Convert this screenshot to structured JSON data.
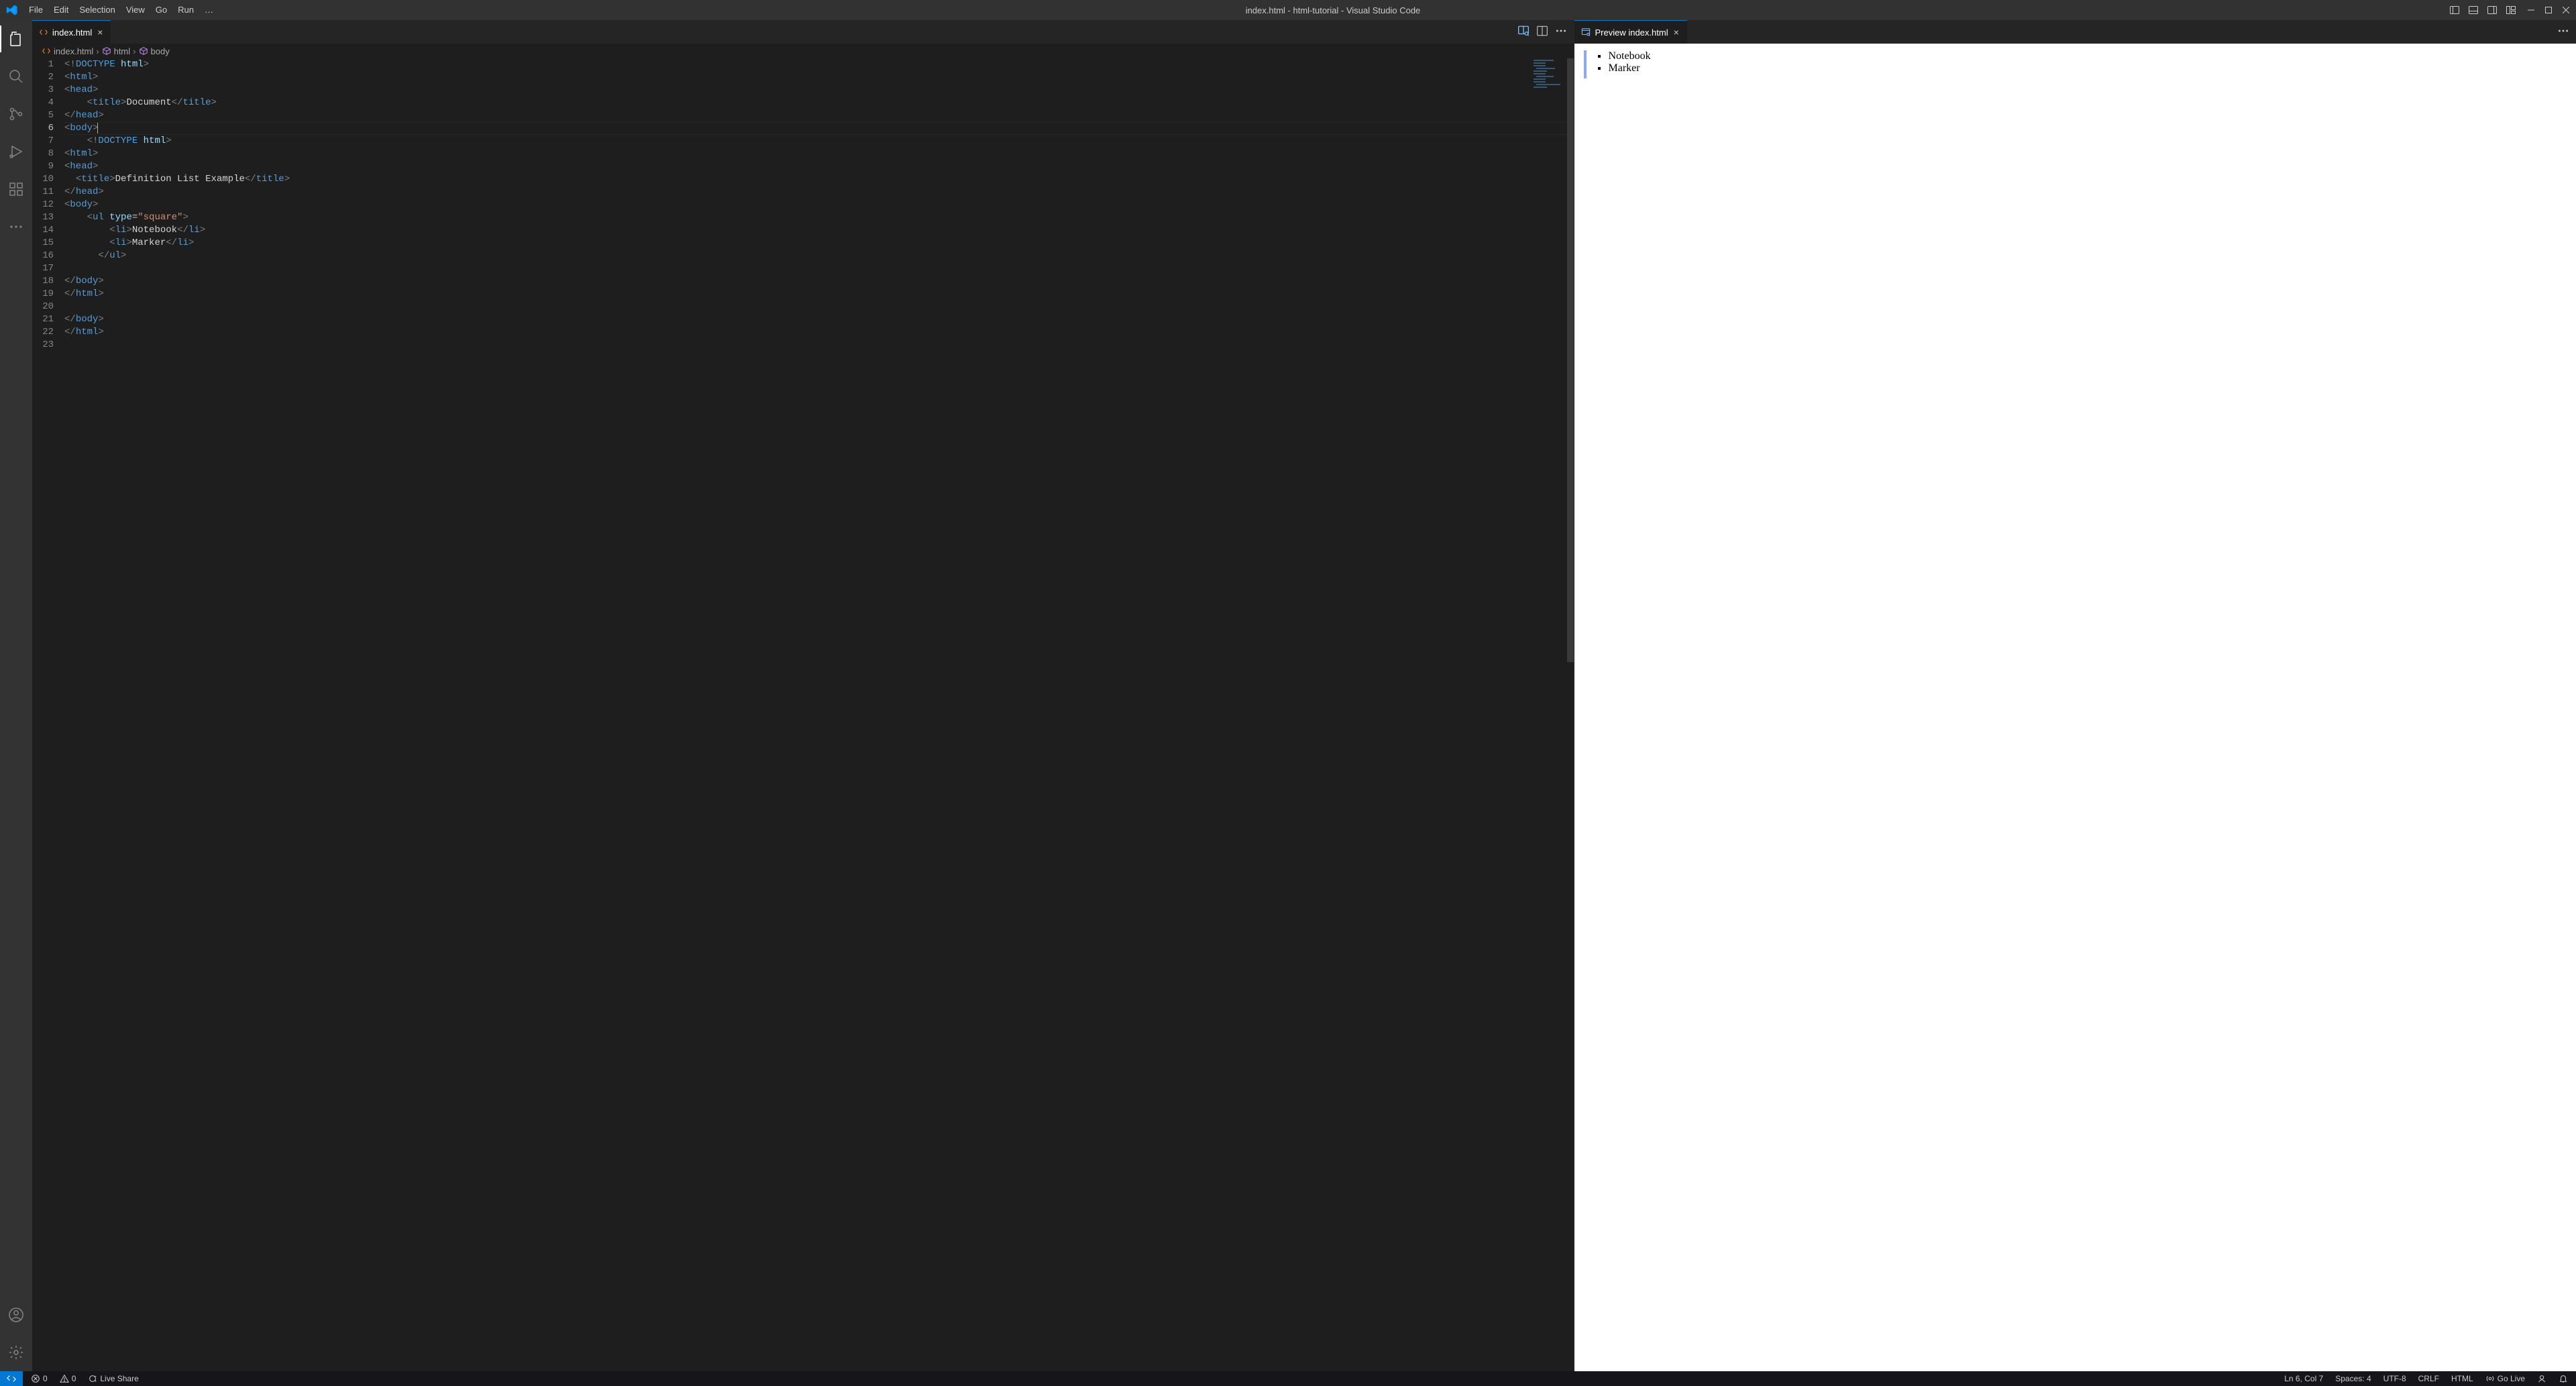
{
  "title_bar": {
    "menu": [
      "File",
      "Edit",
      "Selection",
      "View",
      "Go",
      "Run"
    ],
    "overflow": "…",
    "window_title": "index.html - html-tutorial - Visual Studio Code"
  },
  "activity_bar_items": {
    "explorer": "Explorer",
    "search": "Search",
    "scm": "Source Control",
    "debug": "Run and Debug",
    "extensions": "Extensions",
    "more": "Additional Views",
    "accounts": "Accounts",
    "settings": "Manage"
  },
  "editor_left": {
    "tab_label": "index.html",
    "breadcrumbs": [
      "index.html",
      "html",
      "body"
    ]
  },
  "editor_right": {
    "tab_label": "Preview index.html"
  },
  "preview": {
    "items": [
      "Notebook",
      "Marker"
    ]
  },
  "code_lines": [
    "<!DOCTYPE html>",
    "<html>",
    "<head>",
    "    <title>Document</title>",
    "</head>",
    "<body>",
    "    <!DOCTYPE html>",
    "<html>",
    "<head>",
    "  <title>Definition List Example</title>",
    "</head>",
    "<body>",
    "    <ul type=\"square\">",
    "        <li>Notebook</li>",
    "        <li>Marker</li>",
    "      </ul>",
    "",
    "</body>",
    "</html>",
    "",
    "</body>",
    "</html>",
    ""
  ],
  "status": {
    "errors": "0",
    "warnings": "0",
    "live_share": "Live Share",
    "position": "Ln 6, Col 7",
    "spaces": "Spaces: 4",
    "encoding": "UTF-8",
    "eol": "CRLF",
    "language": "HTML",
    "go_live": "Go Live"
  }
}
